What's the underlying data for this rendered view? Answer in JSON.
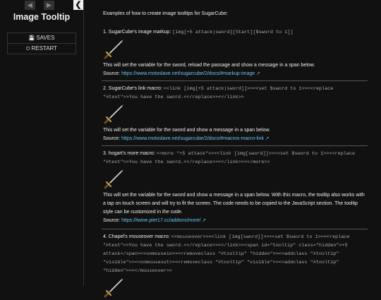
{
  "sidebar": {
    "history_back_icon": "arrow-left",
    "history_forward_icon": "arrow-right",
    "toggle_icon": "chevron-left",
    "toggle_glyph": "❮",
    "back_glyph": "◀",
    "forward_glyph": "▶",
    "title": "Image Tooltip",
    "saves_label": "SAVES",
    "restart_label": "RESTART"
  },
  "passage": {
    "intro": "Examples of how to create image tooltips for SugarCube:",
    "sections": [
      {
        "heading": "1. SugarCube's image markup:",
        "code": "[img[+5 attack|sword][Start][$sword to 1]]",
        "description": "This will set the variable for the sword, reload the passage and show a message in a span below.",
        "source_label": "Source:",
        "source_link": "https://www.motoslave.net/sugarcube/2/docs/#markup-image"
      },
      {
        "heading": "2. SugarCube's link macro:",
        "code": "<<link [img[+5 attack|sword]]>><<set $sword to 1>><<replace \"#text\">>You have the sword.<</replace>><</link>>",
        "description": "This will set the variable for the sword and show a message in a span below.",
        "source_label": "Source:",
        "source_link": "https://www.motoslave.net/sugarcube/2/docs/#macros-macro-link"
      },
      {
        "heading": "3. hogart's more macro:",
        "code": "<<more \"+5 attack\">><<link [img[sword]]>><<set $sword to 1>><<replace \"#text\">>You have the sword.<</replace>><</link>><</more>>",
        "description": "This will set the variable for the sword and show a message in a span below. With this macro, the tooltip also works with a tap on touch screen and will try to fit the screen. The code needs to be copied to the JavaScript section. The tooltip style can be customized in the code.",
        "source_label": "Source:",
        "source_link": "https://twine.pier17.cc/addons/more/"
      },
      {
        "heading": "4. Chapel's mouseover macro:",
        "code": "<<mouseover>><<link [img[sword]]>><<set $sword to 1>><<replace \"#text\">>You have the sword.<</replace>><</link>><span id=\"tooltip\" class=\"hidden\">+5 attack</span><<onmousein>><<removeclass \"#tooltip\" \"hidden\">><<addclass \"#tooltip\" \"visible\">><<onmouseout>><<removeclass \"#tooltip\" \"visible\">><<addclass \"#tooltip\" \"hidden\">><</mouseover>>"
      }
    ]
  },
  "icons": {
    "saves": "floppy-disk-icon",
    "restart": "power-icon",
    "external_link": "external-link-icon",
    "sword": "sword-image"
  },
  "colors": {
    "background": "#111111",
    "link": "#68c6f2",
    "divider": "#555555"
  }
}
